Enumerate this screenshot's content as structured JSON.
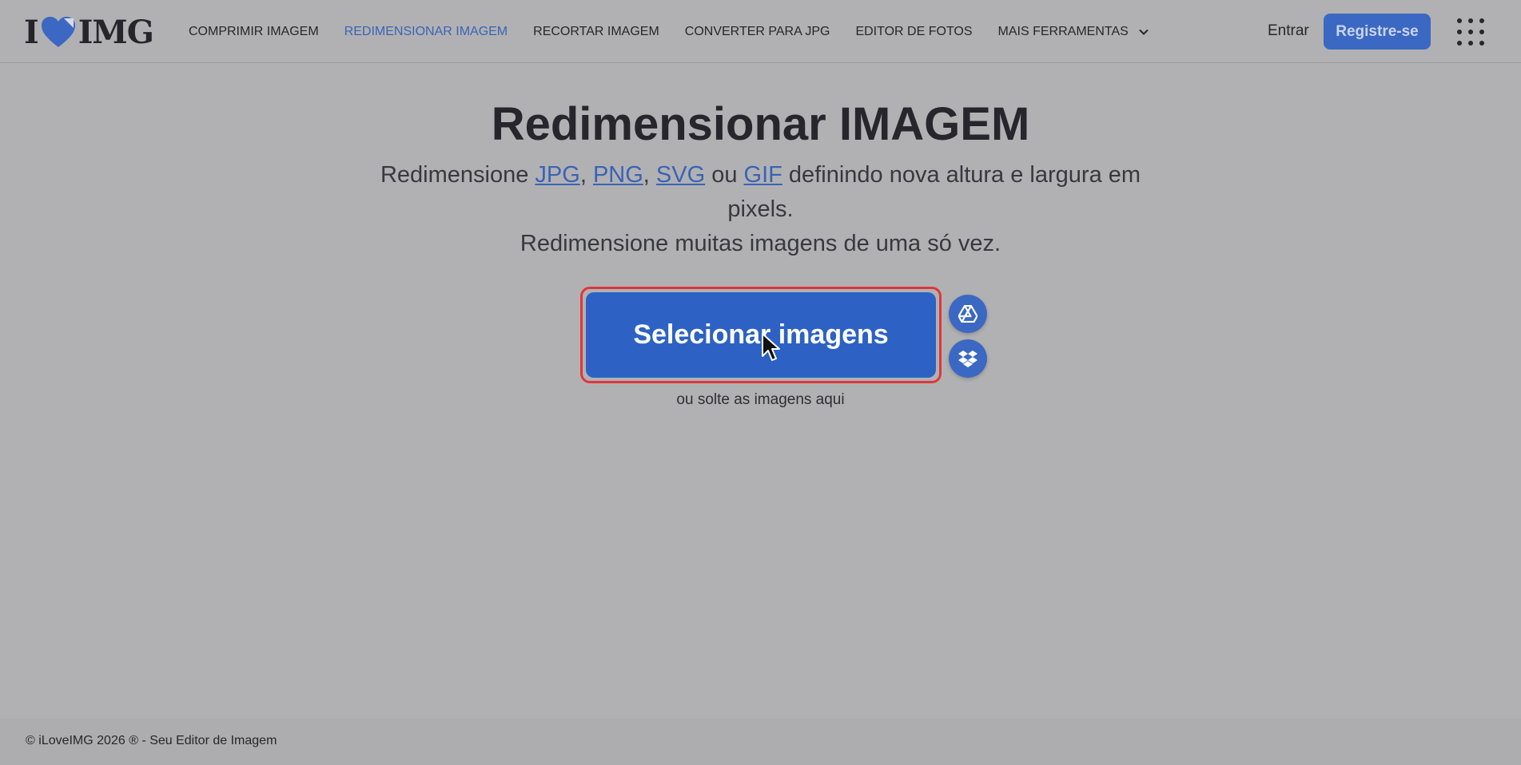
{
  "header": {
    "logo": {
      "left": "I",
      "right": "IMG"
    },
    "nav": [
      {
        "label": "COMPRIMIR IMAGEM",
        "active": false
      },
      {
        "label": "REDIMENSIONAR IMAGEM",
        "active": true
      },
      {
        "label": "RECORTAR IMAGEM",
        "active": false
      },
      {
        "label": "CONVERTER PARA JPG",
        "active": false
      },
      {
        "label": "EDITOR DE FOTOS",
        "active": false
      }
    ],
    "more_tools": "MAIS FERRAMENTAS",
    "login": "Entrar",
    "register": "Registre-se"
  },
  "main": {
    "title": "Redimensionar IMAGEM",
    "subtitle": {
      "prefix": "Redimensione ",
      "formats": [
        "JPG",
        "PNG",
        "SVG",
        "GIF"
      ],
      "sep": ", ",
      "or": " ou ",
      "suffix": " definindo nova altura e largura em pixels.",
      "line2": "Redimensione muitas imagens de uma só vez."
    },
    "select_button": "Selecionar imagens",
    "drop_hint": "ou solte as imagens aqui",
    "cloud_icons": [
      "google-drive-icon",
      "dropbox-icon"
    ]
  },
  "footer": {
    "text": "© iLoveIMG 2026 ® - Seu Editor de Imagem"
  },
  "colors": {
    "accent": "#3b68c2",
    "select_button": "#2d62c4",
    "highlight_border": "#e0363a",
    "active_nav": "#3a63b6"
  }
}
